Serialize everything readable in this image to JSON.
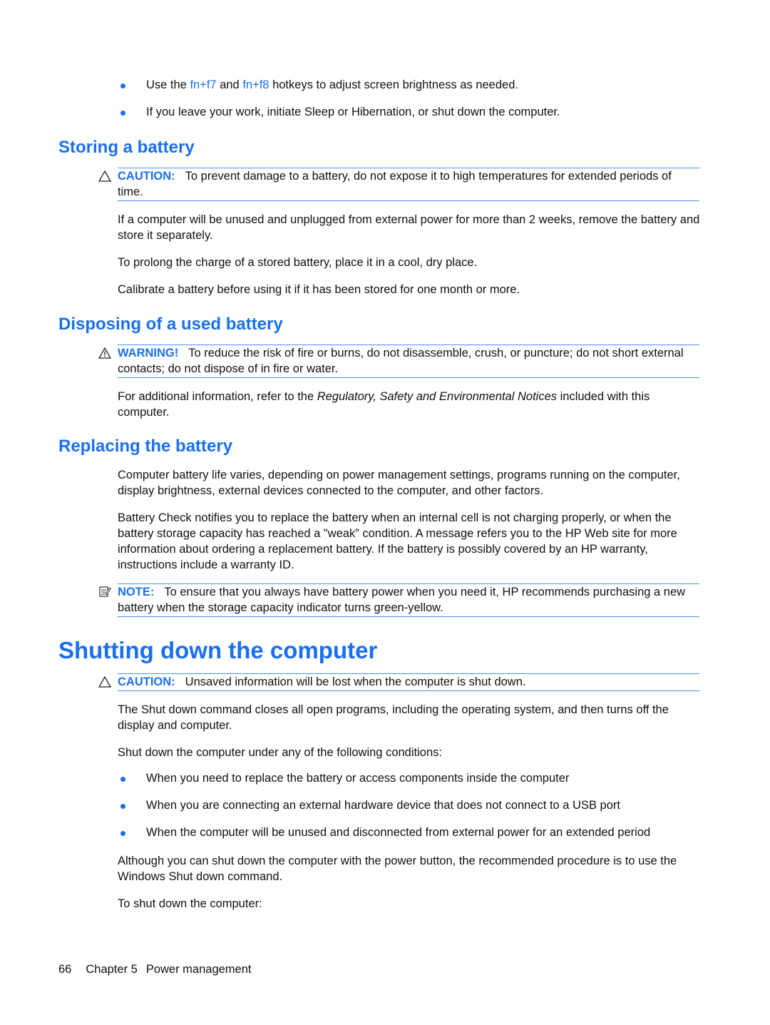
{
  "top_bullets": [
    {
      "pre": "Use the ",
      "key1": "fn+f7",
      "mid": " and ",
      "key2": "fn+f8",
      "post": " hotkeys to adjust screen brightness as needed."
    },
    {
      "text": "If you leave your work, initiate Sleep or Hibernation, or shut down the computer."
    }
  ],
  "storing": {
    "heading": "Storing a battery",
    "caution_label": "CAUTION:",
    "caution_text": "To prevent damage to a battery, do not expose it to high temperatures for extended periods of time.",
    "paragraphs": [
      "If a computer will be unused and unplugged from external power for more than 2 weeks, remove the battery and store it separately.",
      "To prolong the charge of a stored battery, place it in a cool, dry place.",
      "Calibrate a battery before using it if it has been stored for one month or more."
    ]
  },
  "disposing": {
    "heading": "Disposing of a used battery",
    "warning_label": "WARNING!",
    "warning_text": "To reduce the risk of fire or burns, do not disassemble, crush, or puncture; do not short external contacts; do not dispose of in fire or water.",
    "para_pre": "For additional information, refer to the ",
    "para_italic": "Regulatory, Safety and Environmental Notices",
    "para_post": " included with this computer."
  },
  "replacing": {
    "heading": "Replacing the battery",
    "paragraphs": [
      "Computer battery life varies, depending on power management settings, programs running on the computer, display brightness, external devices connected to the computer, and other factors.",
      "Battery Check notifies you to replace the battery when an internal cell is not charging properly, or when the battery storage capacity has reached a \"weak” condition. A message refers you to the HP Web site for more information about ordering a replacement battery. If the battery is possibly covered by an HP warranty, instructions include a warranty ID."
    ],
    "note_label": "NOTE:",
    "note_text": "To ensure that you always have battery power when you need it, HP recommends purchasing a new battery when the storage capacity indicator turns green-yellow."
  },
  "shutting": {
    "heading": "Shutting down the computer",
    "caution_label": "CAUTION:",
    "caution_text": "Unsaved information will be lost when the computer is shut down.",
    "para1": "The Shut down command closes all open programs, including the operating system, and then turns off the display and computer.",
    "para2": "Shut down the computer under any of the following conditions:",
    "bullets": [
      "When you need to replace the battery or access components inside the computer",
      "When you are connecting an external hardware device that does not connect to a USB port",
      "When the computer will be unused and disconnected from external power for an extended period"
    ],
    "para3": "Although you can shut down the computer with the power button, the recommended procedure is to use the Windows Shut down command.",
    "para4": "To shut down the computer:"
  },
  "footer": {
    "page_number": "66",
    "chapter": "Chapter 5",
    "chapter_title": "Power management"
  }
}
